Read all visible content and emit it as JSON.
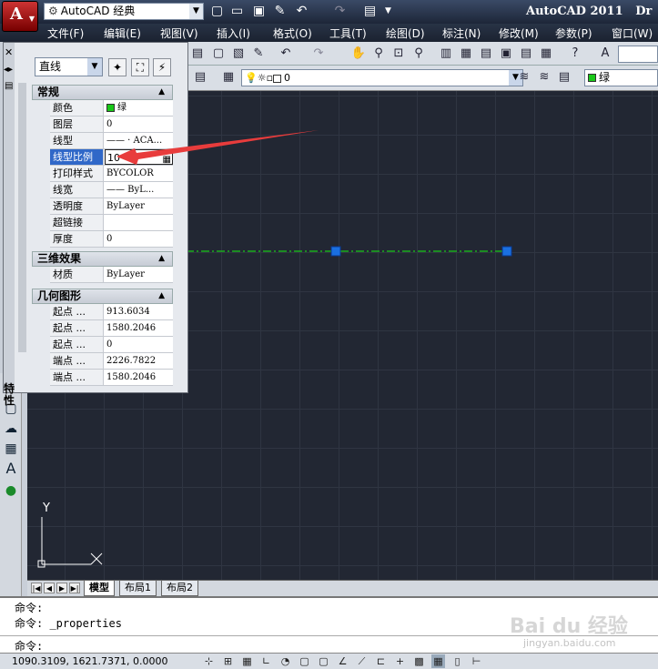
{
  "titlebar": {
    "workspace": "AutoCAD 经典",
    "app_title": "AutoCAD 2011   Dr"
  },
  "menubar": {
    "items": [
      "文件(F)",
      "编辑(E)",
      "视图(V)",
      "插入(I)",
      "格式(O)",
      "工具(T)",
      "绘图(D)",
      "标注(N)",
      "修改(M)",
      "参数(P)",
      "窗口(W)"
    ]
  },
  "layer_toolbar": {
    "layer_name": "0",
    "color_value": "绿",
    "color_hex": "#19c819"
  },
  "properties": {
    "object_type": "直线",
    "sections": [
      {
        "title": "常规",
        "rows": [
          {
            "key": "颜色",
            "value": "绿"
          },
          {
            "key": "图层",
            "value": "0"
          },
          {
            "key": "线型",
            "value": "—— · ACA..."
          },
          {
            "key": "线型比例",
            "value": "10"
          },
          {
            "key": "打印样式",
            "value": "BYCOLOR"
          },
          {
            "key": "线宽",
            "value": "—— ByL..."
          },
          {
            "key": "透明度",
            "value": "ByLayer"
          },
          {
            "key": "超链接",
            "value": ""
          },
          {
            "key": "厚度",
            "value": "0"
          }
        ]
      },
      {
        "title": "三维效果",
        "rows": [
          {
            "key": "材质",
            "value": "ByLayer"
          }
        ]
      },
      {
        "title": "几何图形",
        "rows": [
          {
            "key": "起点 ...",
            "value": "913.6034"
          },
          {
            "key": "起点 ...",
            "value": "1580.2046"
          },
          {
            "key": "起点 ...",
            "value": "0"
          },
          {
            "key": "端点 ...",
            "value": "2226.7822"
          },
          {
            "key": "端点 ...",
            "value": "1580.2046"
          }
        ]
      }
    ],
    "palette_title": "特性"
  },
  "drawing": {
    "ucs_y": "Y",
    "line_color": "#19c819",
    "grip_color": "#1a6fe0"
  },
  "tabs": {
    "items": [
      "模型",
      "布局1",
      "布局2"
    ],
    "active": "模型"
  },
  "command": {
    "lines": [
      "命令:",
      "命令: _properties",
      "命令:"
    ]
  },
  "status": {
    "coords": "1090.3109,  1621.7371,  0.0000"
  },
  "watermark": {
    "main": "Bai du 经验",
    "sub": "jingyan.baidu.com"
  },
  "colors": {
    "arrow": "#e83c3c",
    "selection": "#3068c8"
  }
}
